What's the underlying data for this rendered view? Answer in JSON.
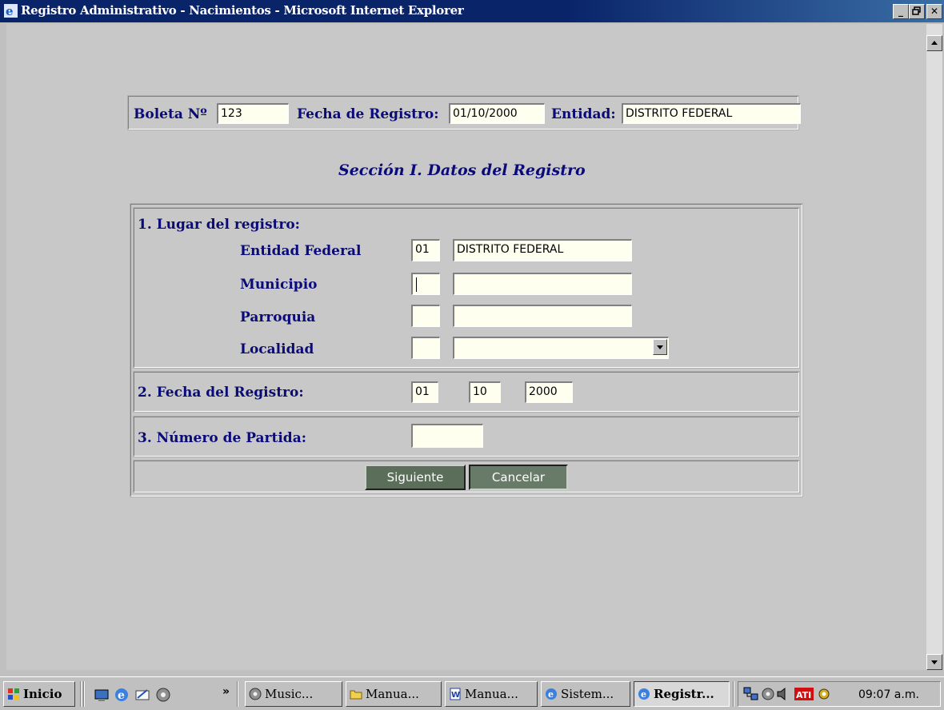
{
  "window": {
    "title": "Registro Administrativo - Nacimientos - Microsoft Internet Explorer",
    "minimize": "_",
    "maximize": "▫",
    "close": "✕"
  },
  "header": {
    "boleta_label": "Boleta Nº",
    "boleta_value": "123",
    "fecha_label": "Fecha de Registro:",
    "fecha_value": "01/10/2000",
    "entidad_label": "Entidad:",
    "entidad_value": "DISTRITO FEDERAL"
  },
  "section_title": "Sección I. Datos del Registro",
  "lugar": {
    "heading": "1. Lugar del registro:",
    "entidad_federal": {
      "label": "Entidad Federal",
      "code": "01",
      "name": "DISTRITO FEDERAL"
    },
    "municipio": {
      "label": "Municipio",
      "code": "",
      "name": ""
    },
    "parroquia": {
      "label": "Parroquia",
      "code": "",
      "name": ""
    },
    "localidad": {
      "label": "Localidad",
      "code": "",
      "selected": ""
    }
  },
  "fecha_registro": {
    "heading": "2. Fecha del Registro:",
    "day": "01",
    "month": "10",
    "year": "2000"
  },
  "numero_partida": {
    "heading": "3. Número de Partida:",
    "value": ""
  },
  "buttons": {
    "siguiente": "Siguiente",
    "cancelar": "Cancelar"
  },
  "taskbar": {
    "start": "Inicio",
    "chevron": "»",
    "tasks": [
      "Music...",
      "Manua...",
      "Manua...",
      "Sistem...",
      "Registr..."
    ],
    "clock": "09:07 a.m."
  },
  "colors": {
    "label": "#0a0a78",
    "field_bg": "#fffff0",
    "button_bg": "#5a6e5a",
    "titlebar": "#0a246a"
  }
}
